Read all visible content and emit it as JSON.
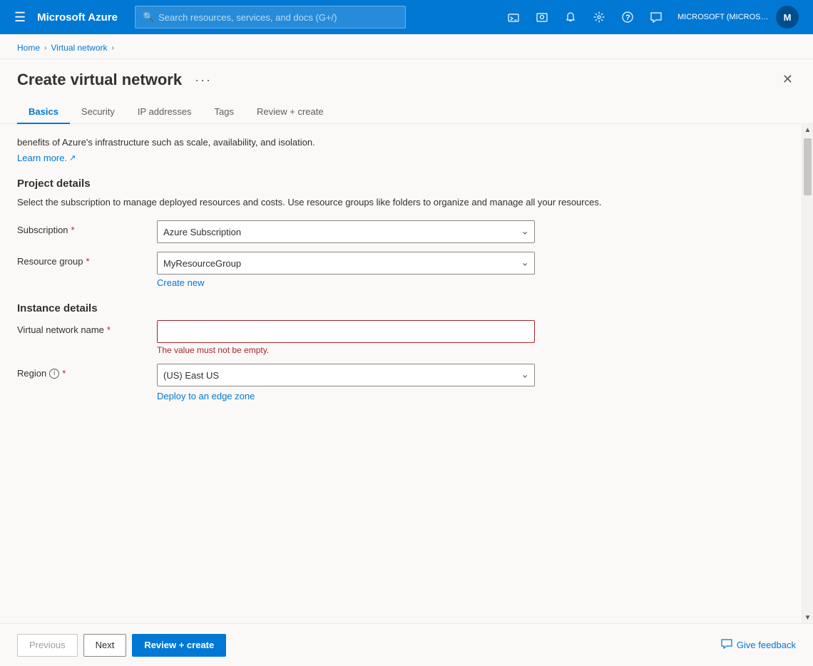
{
  "topnav": {
    "hamburger_label": "☰",
    "brand": "Microsoft Azure",
    "search_placeholder": "Search resources, services, and docs (G+/)",
    "account_text": "MICROSOFT (MICROSOFT.ONMI...",
    "icons": [
      "✉",
      "🖥",
      "🔔",
      "⚙",
      "?",
      "💬"
    ]
  },
  "breadcrumb": {
    "home": "Home",
    "sep1": "›",
    "virtual_network": "Virtual network",
    "sep2": "›"
  },
  "panel": {
    "title": "Create virtual network",
    "more_icon": "···",
    "close_icon": "✕"
  },
  "tabs": [
    {
      "id": "basics",
      "label": "Basics",
      "active": true
    },
    {
      "id": "security",
      "label": "Security",
      "active": false
    },
    {
      "id": "ip-addresses",
      "label": "IP addresses",
      "active": false
    },
    {
      "id": "tags",
      "label": "Tags",
      "active": false
    },
    {
      "id": "review-create",
      "label": "Review + create",
      "active": false
    }
  ],
  "intro": {
    "text": "benefits of Azure's infrastructure such as scale, availability, and isolation.",
    "learn_more": "Learn more.",
    "learn_more_icon": "↗"
  },
  "project_details": {
    "title": "Project details",
    "description": "Select the subscription to manage deployed resources and costs. Use resource groups like folders to organize and manage all your resources."
  },
  "fields": {
    "subscription": {
      "label": "Subscription",
      "required": true,
      "value": "Azure Subscription",
      "options": [
        "Azure Subscription"
      ]
    },
    "resource_group": {
      "label": "Resource group",
      "required": true,
      "value": "MyResourceGroup",
      "options": [
        "MyResourceGroup"
      ],
      "create_new": "Create new"
    },
    "instance_details_title": "Instance details",
    "virtual_network_name": {
      "label": "Virtual network name",
      "required": true,
      "value": "",
      "placeholder": "",
      "error": "The value must not be empty."
    },
    "region": {
      "label": "Region",
      "required": true,
      "info": true,
      "value": "(US) East US",
      "options": [
        "(US) East US"
      ],
      "edge_zone_link": "Deploy to an edge zone"
    }
  },
  "footer": {
    "previous": "Previous",
    "next": "Next",
    "review_create": "Review + create",
    "feedback": "Give feedback",
    "feedback_icon": "💬"
  }
}
